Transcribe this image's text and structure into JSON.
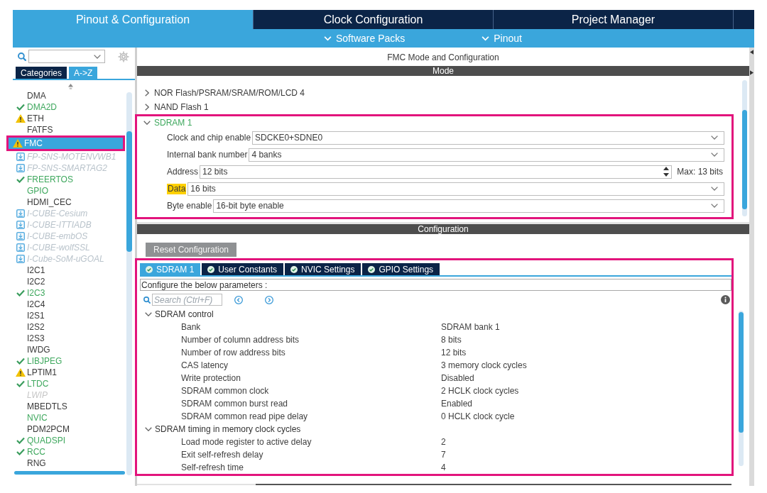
{
  "tabs": [
    {
      "label": "Pinout & Configuration",
      "selected": true
    },
    {
      "label": "Clock Configuration",
      "selected": false
    },
    {
      "label": "Project Manager",
      "selected": false
    }
  ],
  "sub_menu": [
    "Software Packs",
    "Pinout"
  ],
  "sidebar": {
    "view_tabs": [
      {
        "label": "Categories",
        "selected": false
      },
      {
        "label": "A->Z",
        "selected": true
      }
    ],
    "items": [
      {
        "label": "DMA",
        "kind": "plain",
        "selected": false,
        "annotated": false
      },
      {
        "label": "DMA2D",
        "kind": "configured",
        "selected": false,
        "annotated": false
      },
      {
        "label": "ETH",
        "kind": "warning",
        "selected": false,
        "annotated": false
      },
      {
        "label": "FATFS",
        "kind": "plain",
        "selected": false,
        "annotated": false
      },
      {
        "label": "FMC",
        "kind": "warning",
        "selected": true,
        "annotated": true
      },
      {
        "label": "FP-SNS-MOTENVWB1",
        "kind": "pack",
        "selected": false,
        "annotated": false
      },
      {
        "label": "FP-SNS-SMARTAG2",
        "kind": "pack",
        "selected": false,
        "annotated": false
      },
      {
        "label": "FREERTOS",
        "kind": "configured",
        "selected": false,
        "annotated": false
      },
      {
        "label": "GPIO",
        "kind": "active",
        "selected": false,
        "annotated": false
      },
      {
        "label": "HDMI_CEC",
        "kind": "plain",
        "selected": false,
        "annotated": false
      },
      {
        "label": "I-CUBE-Cesium",
        "kind": "pack",
        "selected": false,
        "annotated": false
      },
      {
        "label": "I-CUBE-ITTIADB",
        "kind": "pack",
        "selected": false,
        "annotated": false
      },
      {
        "label": "I-CUBE-embOS",
        "kind": "pack",
        "selected": false,
        "annotated": false
      },
      {
        "label": "I-CUBE-wolfSSL",
        "kind": "pack",
        "selected": false,
        "annotated": false
      },
      {
        "label": "I-Cube-SoM-uGOAL",
        "kind": "pack",
        "selected": false,
        "annotated": false
      },
      {
        "label": "I2C1",
        "kind": "plain",
        "selected": false,
        "annotated": false
      },
      {
        "label": "I2C2",
        "kind": "plain",
        "selected": false,
        "annotated": false
      },
      {
        "label": "I2C3",
        "kind": "configured",
        "selected": false,
        "annotated": false
      },
      {
        "label": "I2C4",
        "kind": "plain",
        "selected": false,
        "annotated": false
      },
      {
        "label": "I2S1",
        "kind": "plain",
        "selected": false,
        "annotated": false
      },
      {
        "label": "I2S2",
        "kind": "plain",
        "selected": false,
        "annotated": false
      },
      {
        "label": "I2S3",
        "kind": "plain",
        "selected": false,
        "annotated": false
      },
      {
        "label": "IWDG",
        "kind": "plain",
        "selected": false,
        "annotated": false
      },
      {
        "label": "LIBJPEG",
        "kind": "configured",
        "selected": false,
        "annotated": false
      },
      {
        "label": "LPTIM1",
        "kind": "warning",
        "selected": false,
        "annotated": false
      },
      {
        "label": "LTDC",
        "kind": "configured",
        "selected": false,
        "annotated": false
      },
      {
        "label": "LWIP",
        "kind": "unavailable",
        "selected": false,
        "annotated": false
      },
      {
        "label": "MBEDTLS",
        "kind": "plain",
        "selected": false,
        "annotated": false
      },
      {
        "label": "NVIC",
        "kind": "active",
        "selected": false,
        "annotated": false
      },
      {
        "label": "PDM2PCM",
        "kind": "plain",
        "selected": false,
        "annotated": false
      },
      {
        "label": "QUADSPI",
        "kind": "configured",
        "selected": false,
        "annotated": false
      },
      {
        "label": "RCC",
        "kind": "configured",
        "selected": false,
        "annotated": false
      },
      {
        "label": "RNG",
        "kind": "plain",
        "selected": false,
        "annotated": false
      }
    ]
  },
  "panel": {
    "title": "FMC Mode and Configuration",
    "mode": {
      "header": "Mode",
      "tree": [
        {
          "label": "NOR Flash/PSRAM/SRAM/ROM/LCD 4",
          "expanded": false,
          "configured": false,
          "annotated": false
        },
        {
          "label": "NAND Flash 1",
          "expanded": false,
          "configured": false,
          "annotated": false
        },
        {
          "label": "SDRAM 1",
          "expanded": true,
          "configured": true,
          "annotated": true,
          "fields": [
            {
              "kind": "select",
              "label": "Clock and chip enable",
              "value": "SDCKE0+SDNE0",
              "highlighted": false
            },
            {
              "kind": "select",
              "label": "Internal bank number",
              "value": "4 banks",
              "highlighted": false
            },
            {
              "kind": "spinner",
              "label": "Address",
              "value": "12 bits",
              "note": "Max: 13 bits",
              "highlighted": false
            },
            {
              "kind": "select",
              "label": "Data",
              "value": "16 bits",
              "highlighted": true
            },
            {
              "kind": "select",
              "label": "Byte enable",
              "value": "16-bit byte enable",
              "highlighted": false
            }
          ]
        }
      ]
    },
    "configuration": {
      "header": "Configuration",
      "reset_button": "Reset Configuration",
      "annotated": true,
      "tabs": [
        {
          "label": "SDRAM 1",
          "selected": true
        },
        {
          "label": "User Constants",
          "selected": false
        },
        {
          "label": "NVIC Settings",
          "selected": false
        },
        {
          "label": "GPIO Settings",
          "selected": false
        }
      ],
      "hint": "Configure the below parameters :",
      "search": {
        "placeholder": "Search (Ctrl+F)"
      },
      "groups": [
        {
          "label": "SDRAM control",
          "expanded": true,
          "params": [
            {
              "name": "Bank",
              "value": "SDRAM bank 1"
            },
            {
              "name": "Number of column address bits",
              "value": "8 bits"
            },
            {
              "name": "Number of row address bits",
              "value": "12 bits"
            },
            {
              "name": "CAS latency",
              "value": "3 memory clock cycles"
            },
            {
              "name": "Write protection",
              "value": "Disabled"
            },
            {
              "name": "SDRAM common clock",
              "value": "2 HCLK clock cycles"
            },
            {
              "name": "SDRAM common burst read",
              "value": "Enabled"
            },
            {
              "name": "SDRAM common read pipe delay",
              "value": "0 HCLK clock cycle"
            }
          ]
        },
        {
          "label": "SDRAM timing in memory clock cycles",
          "expanded": true,
          "params": [
            {
              "name": "Load mode register to active delay",
              "value": "2"
            },
            {
              "name": "Exit self-refresh delay",
              "value": "7"
            },
            {
              "name": "Self-refresh time",
              "value": "4"
            }
          ]
        }
      ]
    }
  }
}
